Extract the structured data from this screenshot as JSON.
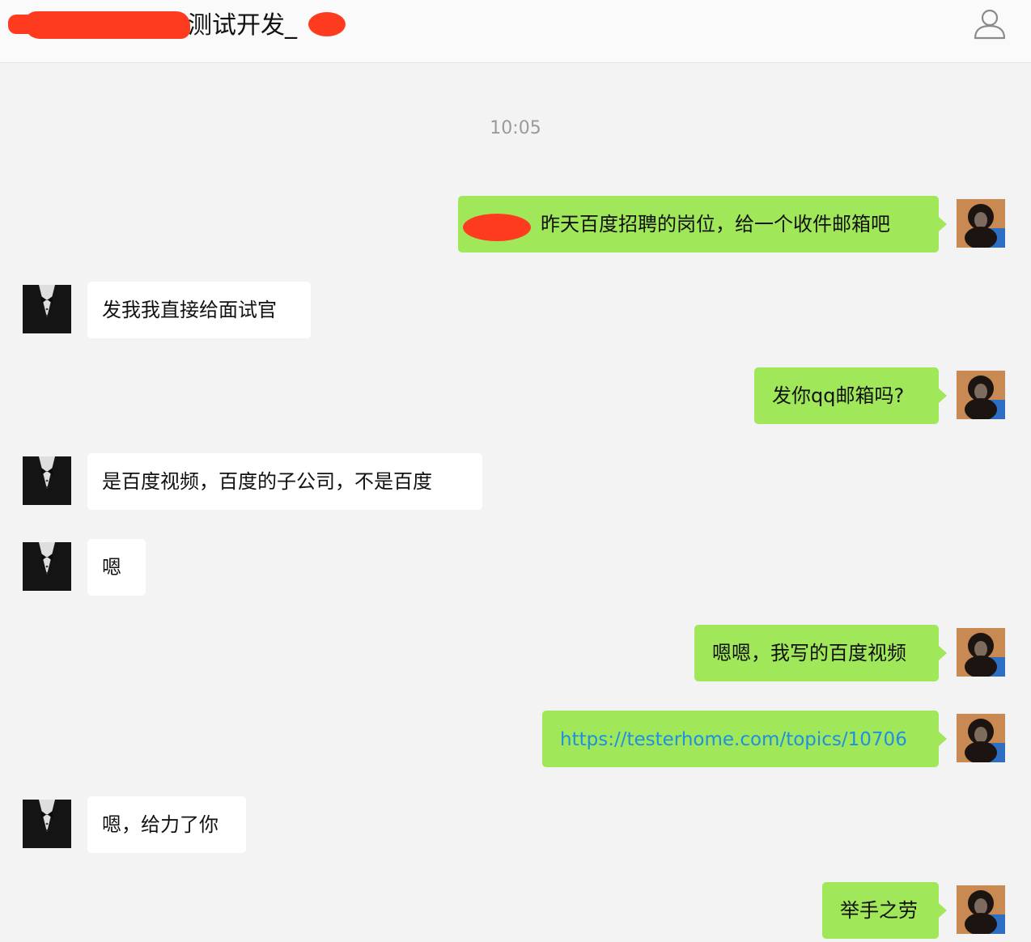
{
  "header": {
    "title": "测试开发_",
    "user_icon": "user-outline-icon"
  },
  "chat": {
    "timestamp": "10:05",
    "messages": [
      {
        "side": "right",
        "text": "昨天百度招聘的岗位，给一个收件邮箱吧"
      },
      {
        "side": "left",
        "text": "发我我直接给面试官"
      },
      {
        "side": "right",
        "text": "发你qq邮箱吗?"
      },
      {
        "side": "left",
        "text": "是百度视频，百度的子公司，不是百度"
      },
      {
        "side": "left",
        "text": "嗯"
      },
      {
        "side": "right",
        "text": "嗯嗯，我写的百度视频"
      },
      {
        "side": "right",
        "text": "https://testerhome.com/topics/10706"
      },
      {
        "side": "left",
        "text": "嗯，给力了你"
      },
      {
        "side": "right",
        "text": "举手之劳"
      }
    ]
  },
  "colors": {
    "self_bubble": "#a0e75a",
    "other_bubble": "#ffffff",
    "background": "#f3f3f3",
    "link": "#1f8fe0",
    "redaction": "#ff3b1f"
  },
  "avatars": {
    "self": "monkey-avatar",
    "other": "tuxedo-avatar"
  }
}
